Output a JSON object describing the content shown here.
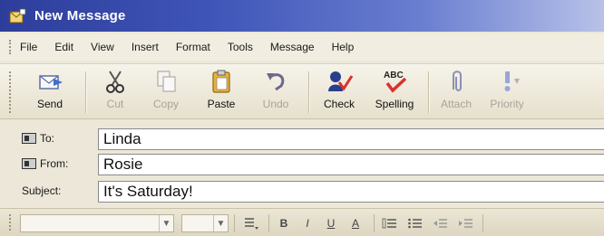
{
  "window": {
    "title": "New Message"
  },
  "menu": [
    "File",
    "Edit",
    "View",
    "Insert",
    "Format",
    "Tools",
    "Message",
    "Help"
  ],
  "toolbar": {
    "send": "Send",
    "cut": "Cut",
    "copy": "Copy",
    "paste": "Paste",
    "undo": "Undo",
    "check": "Check",
    "spelling": "Spelling",
    "attach": "Attach",
    "priority": "Priority"
  },
  "fields": {
    "to": {
      "label": "To:",
      "value": "Linda"
    },
    "from": {
      "label": "From:",
      "value": "Rosie"
    },
    "subject": {
      "label": "Subject:",
      "value": "It's Saturday!"
    }
  },
  "format": {
    "bold": "B",
    "italic": "I",
    "underline": "U",
    "font_color": "A"
  },
  "colors": {
    "title_bar": "#3f55b8",
    "spelling_check": "#d8322a",
    "background": "#ece7d8"
  }
}
